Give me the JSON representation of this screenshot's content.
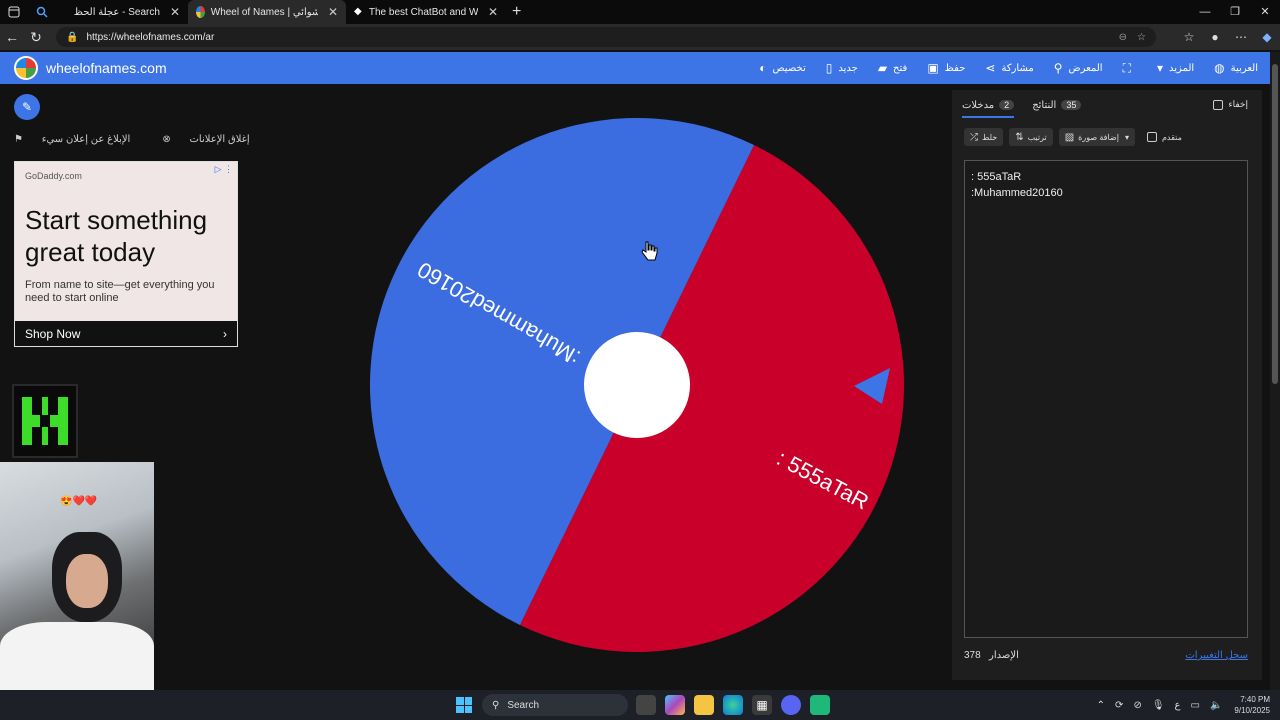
{
  "browser": {
    "tabs": [
      {
        "label": "عجلة الحظ - Search",
        "active": false
      },
      {
        "label": "Wheel of Names | الاسم العشوائي",
        "active": true
      },
      {
        "label": "The best ChatBot and Widgets fo",
        "active": false
      }
    ],
    "url": "https://wheelofnames.com/ar"
  },
  "header": {
    "brand": "wheelofnames.com",
    "nav": [
      {
        "label": "تخصيص",
        "icon": "palette-icon"
      },
      {
        "label": "جديد",
        "icon": "new-file-icon"
      },
      {
        "label": "فتح",
        "icon": "folder-icon"
      },
      {
        "label": "حفظ",
        "icon": "save-icon"
      },
      {
        "label": "مشاركة",
        "icon": "share-icon"
      },
      {
        "label": "المعرض",
        "icon": "search-icon"
      },
      {
        "label": "",
        "icon": "fullscreen-icon"
      },
      {
        "label": "المزيد",
        "icon": "caret-down-icon"
      },
      {
        "label": "العربية",
        "icon": "globe-icon"
      }
    ]
  },
  "ad_controls": {
    "close_ads": "إغلاق الإعلانات",
    "report_ad": "الإبلاغ عن إعلان سيء"
  },
  "ad": {
    "domain": "GoDaddy.com",
    "headline": "Start something great today",
    "sub": "From name to site—get everything you need to start online",
    "cta": "Shop Now"
  },
  "wheel": {
    "segments": [
      {
        "label": ":Muhammed20160",
        "color": "#c8002a"
      },
      {
        "label": ": 555aTaR",
        "color": "#3b6ce0"
      }
    ]
  },
  "panel": {
    "tab_entries": "مدخلات",
    "entries_count": "2",
    "tab_results": "النتائج",
    "results_count": "35",
    "hide_label": "إخفاء",
    "shuffle": "خلط",
    "sort": "ترتيب",
    "add_image": "إضافة صورة",
    "advanced": "متقدم",
    "entries": [
      ": 555aTaR",
      ":Muhammed20160"
    ],
    "version_label": "الإصدار",
    "version": "378",
    "changelog": "سجل التغييرات"
  },
  "taskbar": {
    "search": "Search",
    "time": "7:40 PM",
    "date": "9/10/2025",
    "lang": "ع"
  }
}
